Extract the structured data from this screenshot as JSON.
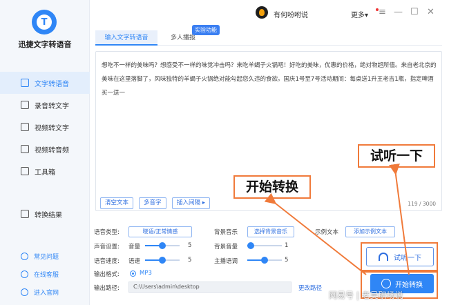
{
  "app": {
    "name": "迅捷文字转语音",
    "logo_letter": "T"
  },
  "topbar": {
    "username": "有何吩咐说",
    "more": "更多",
    "more_chevron": "▾"
  },
  "window_controls": {
    "menu": "≡",
    "minimize": "—",
    "maximize": "☐",
    "close": "✕"
  },
  "sidebar": {
    "items": [
      {
        "label": "文字转语音",
        "icon": "text-to-speech-icon",
        "active": true
      },
      {
        "label": "录音转文字",
        "icon": "recording-icon",
        "active": false
      },
      {
        "label": "视频转文字",
        "icon": "video-to-text-icon",
        "active": false
      },
      {
        "label": "视频转音频",
        "icon": "video-to-audio-icon",
        "active": false
      },
      {
        "label": "工具箱",
        "icon": "toolbox-icon",
        "active": false
      }
    ],
    "result": {
      "label": "转换结果",
      "icon": "result-icon"
    },
    "links": [
      {
        "label": "常见问题",
        "icon": "question-icon"
      },
      {
        "label": "在线客服",
        "icon": "service-icon"
      },
      {
        "label": "进入官网",
        "icon": "website-icon"
      }
    ]
  },
  "tabs": [
    {
      "label": "输入文字转语音",
      "active": true
    },
    {
      "label": "多人播报",
      "active": false
    }
  ],
  "lab_badge": "实验功能",
  "editor": {
    "text": "想吃不一样的美味吗？想感受不一样的味觉冲击吗？来吃羊蝎子火锅吧！好吃的美味，优惠的价格，绝对物超所值。来自老北京的美味在这里落脚了，风味独特的羊蝎子火锅绝对能勾起您久违的食欲。国庆1号至7号活动期间：每桌送1升王老吉1瓶，指定啤酒买一送一",
    "buttons": [
      "清空文本",
      "多音字",
      "插入间隔 ▸"
    ],
    "counter": "119 / 3000"
  },
  "settings": {
    "voice_type_label": "语音类型:",
    "voice_type_value": "晓语/正常情感",
    "bgm_label": "背景音乐",
    "bgm_value": "选择背景音乐",
    "sample_label": "示例文本",
    "sample_value": "添加示例文本",
    "sound_label": "声音设置:",
    "volume_label": "音量",
    "volume_value": "5",
    "volume_level": 0.5,
    "bg_volume_label": "背景音量",
    "bg_volume_value": "1",
    "bg_volume_level": 0.1,
    "speed_label": "语音速度:",
    "speed_name": "语速",
    "speed_value": "5",
    "speed_level": 0.5,
    "pitch_label": "主播语调",
    "pitch_value": "5",
    "pitch_level": 0.5,
    "format_label": "输出格式:",
    "format_value": "MP3",
    "path_label": "输出路径:",
    "path_value": "C:\\Users\\admin\\desktop",
    "change_path": "更改路径"
  },
  "actions": {
    "listen": "试听一下",
    "start": "开始转换"
  },
  "annotations": {
    "listen": "试听一下",
    "start": "开始转换",
    "color": "#f07a3a"
  },
  "watermark": "网易号 | 老吴职场说",
  "colors": {
    "accent": "#2f86f6",
    "annotation": "#f07a3a"
  }
}
